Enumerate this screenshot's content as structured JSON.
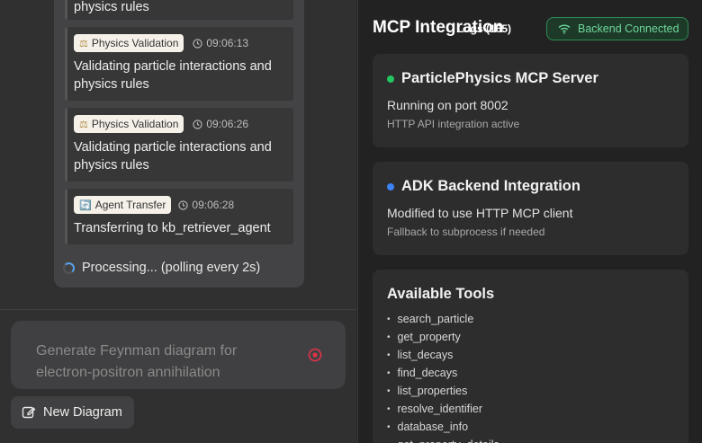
{
  "chat": {
    "entries": [
      {
        "badge": "",
        "badge_icon": "",
        "time": "",
        "message": "physics rules"
      },
      {
        "badge": "Physics Validation",
        "badge_icon": "⚖",
        "time": "09:06:13",
        "message": "Validating particle interactions and physics rules"
      },
      {
        "badge": "Physics Validation",
        "badge_icon": "⚖",
        "time": "09:06:26",
        "message": "Validating particle interactions and physics rules"
      },
      {
        "badge": "Agent Transfer",
        "badge_icon": "🔄",
        "time": "09:06:28",
        "message": "Transferring to kb_retriever_agent"
      }
    ],
    "processing": "Processing... (polling every 2s)",
    "input_placeholder": "Generate Feynman diagram for electron-positron annihilation",
    "new_diagram_label": "New Diagram"
  },
  "panel": {
    "title": "MCP Integration",
    "logs_label": "Logs (165)",
    "status_label": "Backend Connected",
    "cards": [
      {
        "title": "ParticlePhysics MCP Server",
        "line1": "Running on port 8002",
        "line2": "HTTP API integration active",
        "dot_color": "#22c55e"
      },
      {
        "title": "ADK Backend Integration",
        "line1": "Modified to use HTTP MCP client",
        "line2": "Fallback to subprocess if needed",
        "dot_color": "#3b82f6"
      }
    ],
    "tools_title": "Available Tools",
    "tools": [
      "search_particle",
      "get_property",
      "list_decays",
      "find_decays",
      "list_properties",
      "resolve_identifier",
      "database_info",
      "get_property_details"
    ]
  },
  "colors": {
    "accent_green": "#6fd69b",
    "accent_blue": "#5aa0e8",
    "stop_red": "#e0344a"
  }
}
